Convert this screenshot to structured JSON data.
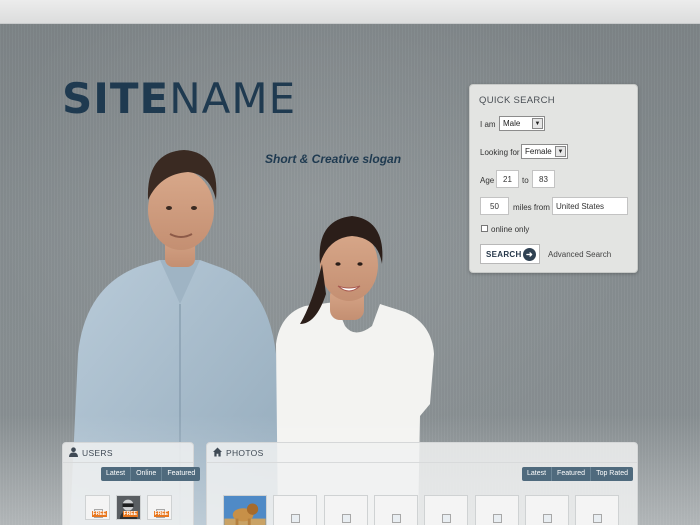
{
  "brand": {
    "name_bold": "SITE",
    "name_light": "NAME",
    "slogan": "Short & Creative slogan"
  },
  "quick_search": {
    "title": "QUICK SEARCH",
    "i_am_label": "I am",
    "i_am_value": "Male",
    "looking_for_label": "Looking for",
    "looking_for_value": "Female",
    "age_label": "Age",
    "age_from": "21",
    "age_to_label": "to",
    "age_to": "83",
    "miles_value": "50",
    "miles_from_label": "miles from",
    "location_value": "United States",
    "online_only_label": "online only",
    "search_button": "SEARCH",
    "advanced_link": "Advanced Search"
  },
  "users_panel": {
    "title": "USERS",
    "tabs": [
      "Latest",
      "Online",
      "Featured"
    ],
    "free_badge": "FREE"
  },
  "photos_panel": {
    "title": "PHOTOS",
    "tabs": [
      "Latest",
      "Featured",
      "Top Rated"
    ]
  },
  "colors": {
    "brand": "#1f3a50",
    "tab_bg": "#4f6a7d",
    "free_badge": "#e8771e"
  }
}
